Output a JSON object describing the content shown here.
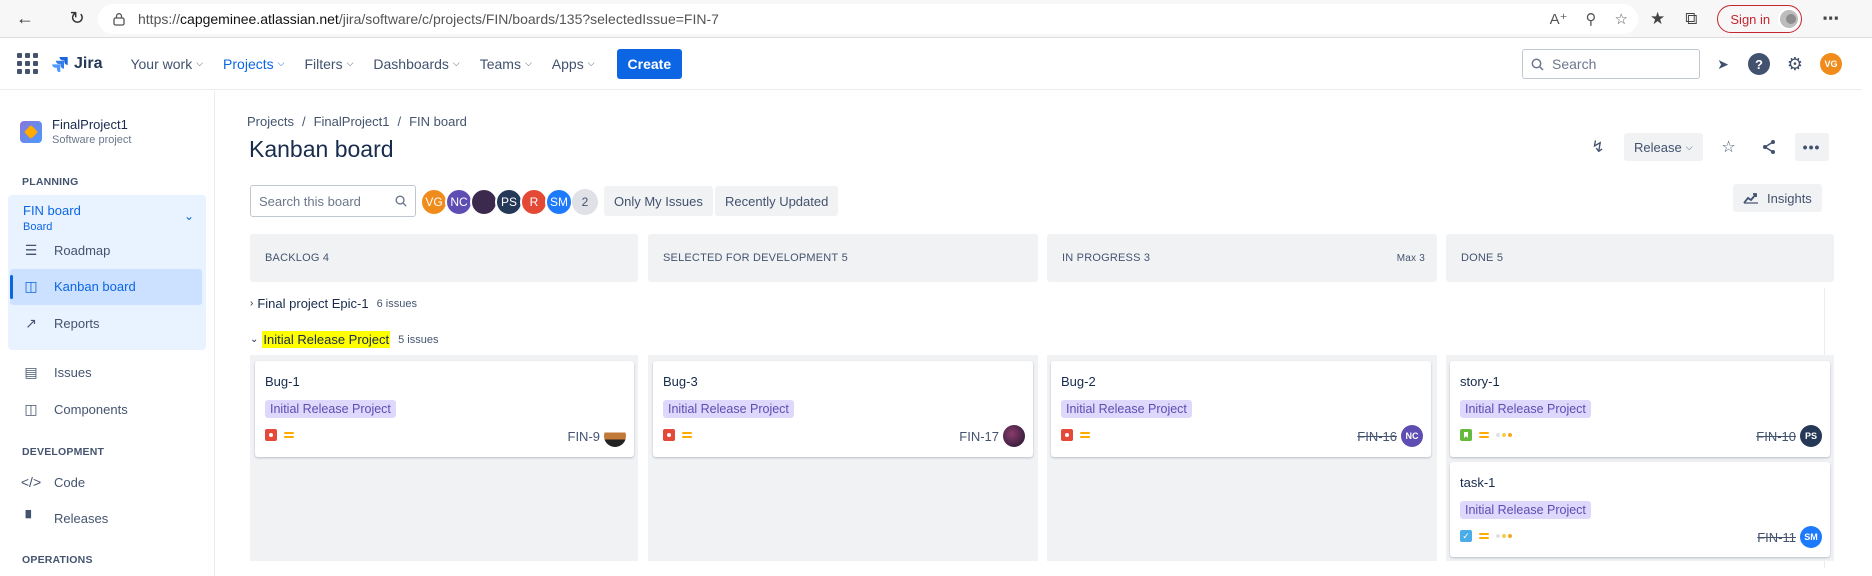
{
  "browser": {
    "url_prefix": "https://",
    "url_host": "capgeminee.atlassian.net",
    "url_path": "/jira/software/c/projects/FIN/boards/135?selectedIssue=FIN-7",
    "signin_label": "Sign in"
  },
  "topnav": {
    "logo": "Jira",
    "items": [
      {
        "label": "Your work"
      },
      {
        "label": "Projects"
      },
      {
        "label": "Filters"
      },
      {
        "label": "Dashboards"
      },
      {
        "label": "Teams"
      },
      {
        "label": "Apps"
      }
    ],
    "create_label": "Create",
    "search_placeholder": "Search",
    "user_initials": "VG"
  },
  "sidebar": {
    "project_name": "FinalProject1",
    "project_type": "Software project",
    "planning_label": "PLANNING",
    "board_title": "FIN board",
    "board_sub": "Board",
    "roadmap": "Roadmap",
    "kanban": "Kanban board",
    "reports": "Reports",
    "issues": "Issues",
    "components": "Components",
    "development_label": "DEVELOPMENT",
    "code": "Code",
    "releases": "Releases",
    "operations_label": "OPERATIONS"
  },
  "breadcrumb": {
    "projects": "Projects",
    "project": "FinalProject1",
    "board": "FIN board",
    "sep": "/"
  },
  "page_title": "Kanban board",
  "header": {
    "release_label": "Release",
    "insights_label": "Insights"
  },
  "toolbar": {
    "search_placeholder": "Search this board",
    "avatars": [
      {
        "initials": "VG",
        "color": "#f08c1b"
      },
      {
        "initials": "NC",
        "color": "#5e4db2"
      },
      {
        "initials": "",
        "color": "#3b2a4d"
      },
      {
        "initials": "PS",
        "color": "#253858"
      },
      {
        "initials": "R",
        "color": "#e34935"
      },
      {
        "initials": "SM",
        "color": "#1d7afc"
      }
    ],
    "more_count": "2",
    "only_my_issues": "Only My Issues",
    "recently_updated": "Recently Updated"
  },
  "columns": [
    {
      "name": "BACKLOG",
      "count": "4",
      "max": ""
    },
    {
      "name": "SELECTED FOR DEVELOPMENT",
      "count": "5",
      "max": ""
    },
    {
      "name": "IN PROGRESS",
      "count": "3",
      "max": "Max 3"
    },
    {
      "name": "DONE",
      "count": "5",
      "max": ""
    }
  ],
  "swimlanes": [
    {
      "name": "Final project Epic-1",
      "count": "6 issues"
    },
    {
      "name": "Initial Release Project",
      "count": "5 issues"
    }
  ],
  "cards": [
    {
      "title": "Bug-1",
      "epic": "Initial Release Project",
      "key": "FIN-9",
      "type": "bug",
      "assignee": "",
      "assignee_color": "#7a4a2a"
    },
    {
      "title": "Bug-3",
      "epic": "Initial Release Project",
      "key": "FIN-17",
      "type": "bug",
      "assignee": "",
      "assignee_color": "#3b2a4d"
    },
    {
      "title": "Bug-2",
      "epic": "Initial Release Project",
      "key": "FIN-16",
      "type": "bug",
      "assignee": "NC",
      "assignee_color": "#5e4db2"
    },
    {
      "title": "story-1",
      "epic": "Initial Release Project",
      "key": "FIN-10",
      "type": "story",
      "assignee": "PS",
      "assignee_color": "#253858"
    },
    {
      "title": "task-1",
      "epic": "Initial Release Project",
      "key": "FIN-11",
      "type": "task",
      "assignee": "SM",
      "assignee_color": "#1d7afc"
    }
  ]
}
